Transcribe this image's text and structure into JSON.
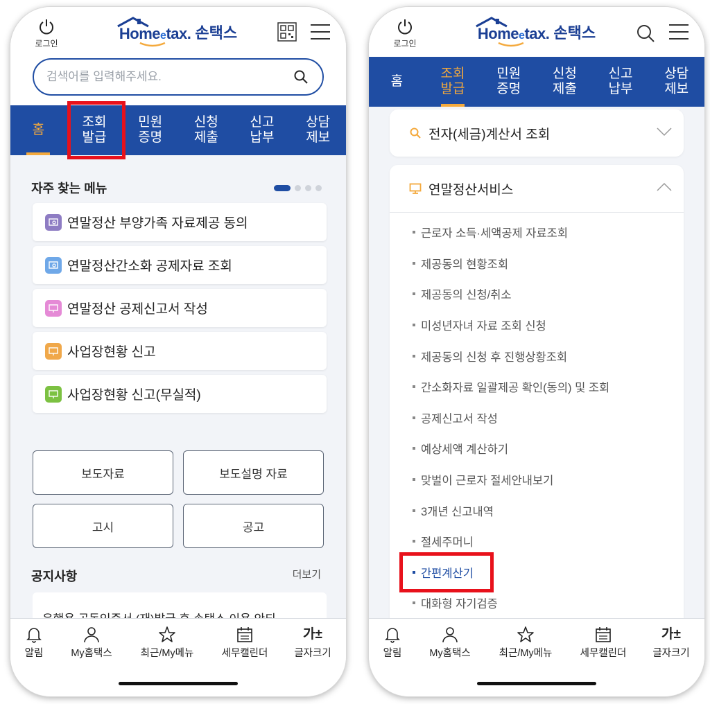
{
  "header": {
    "login_label": "로그인",
    "logo_home": "Home",
    "logo_e": "e",
    "logo_tax": "tax.",
    "logo_brand": "손택스"
  },
  "search": {
    "placeholder": "검색어를 입력해주세요."
  },
  "nav": {
    "tabs": [
      {
        "line1": "홈",
        "line2": ""
      },
      {
        "line1": "조회",
        "line2": "발급"
      },
      {
        "line1": "민원",
        "line2": "증명"
      },
      {
        "line1": "신청",
        "line2": "제출"
      },
      {
        "line1": "신고",
        "line2": "납부"
      },
      {
        "line1": "상담",
        "line2": "제보"
      }
    ]
  },
  "left": {
    "favorites_title": "자주 찾는 메뉴",
    "favorites": [
      {
        "label": "연말정산 부양가족 자료제공 동의",
        "icon_color": "#8e7cc3"
      },
      {
        "label": "연말정산간소화 공제자료 조회",
        "icon_color": "#6fa8e8"
      },
      {
        "label": "연말정산 공제신고서 작성",
        "icon_color": "#e58ad6"
      },
      {
        "label": "사업장현황 신고",
        "icon_color": "#f0a84a"
      },
      {
        "label": "사업장현황 신고(무실적)",
        "icon_color": "#7cc142"
      }
    ],
    "buttons": [
      "보도자료",
      "보도설명 자료",
      "고시",
      "공고"
    ],
    "notice_title": "공지사항",
    "more_label": "더보기",
    "notice_item": "은행용 공동인증서 (재)발급 후 손택스 이용 안되…"
  },
  "right": {
    "acc1_title": "전자(세금)계산서 조회",
    "acc2_title": "연말정산서비스",
    "sub_items": [
      "근로자 소득·세액공제 자료조회",
      "제공동의 현황조회",
      "제공동의 신청/취소",
      "미성년자녀 자료 조회 신청",
      "제공동의 신청 후 진행상황조회",
      "간소화자료 일괄제공 확인(동의) 및 조회",
      "공제신고서 작성",
      "예상세액 계산하기",
      "맞벌이 근로자 절세안내보기",
      "3개년 신고내역",
      "절세주머니",
      "간편계산기",
      "대화형 자기검증"
    ]
  },
  "bottom_nav": {
    "items": [
      "알림",
      "My홈택스",
      "최근/My메뉴",
      "세무캘린더",
      "글자크기"
    ],
    "fontsize_glyph": "가±"
  },
  "colors": {
    "brand_blue": "#1f4da3",
    "accent_orange": "#f4a93c",
    "highlight_red": "#e8111b"
  }
}
